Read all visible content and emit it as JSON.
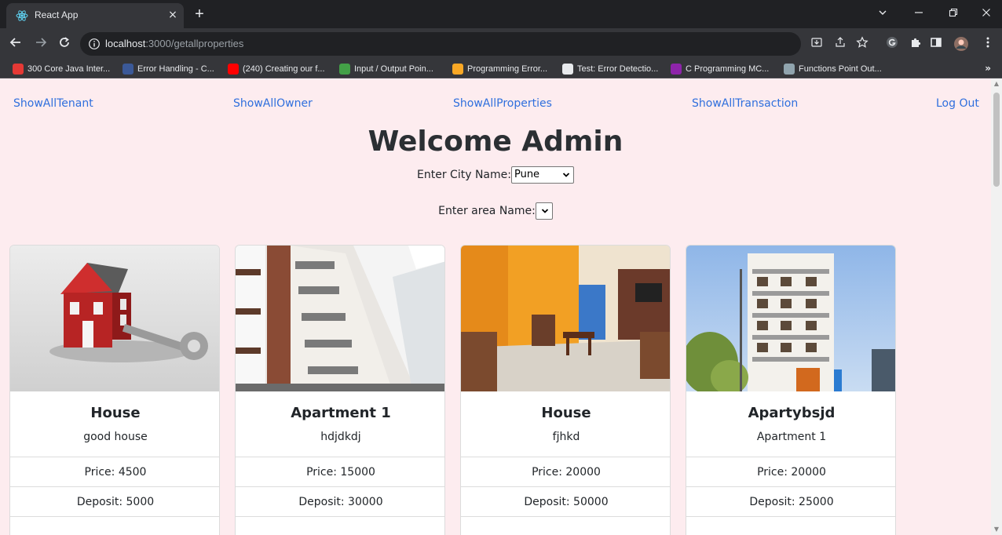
{
  "browser": {
    "tab_title": "React App",
    "tab_close": "×",
    "new_tab": "+",
    "url_host": "localhost",
    "url_rest": ":3000/getallproperties",
    "bookmarks": [
      {
        "label": "300 Core Java Inter...",
        "color": "#e53935"
      },
      {
        "label": "Error Handling - C...",
        "color": "#3b5998"
      },
      {
        "label": "(240) Creating our f...",
        "color": "#ff0000"
      },
      {
        "label": "Input / Output Poin...",
        "color": "#43a047"
      },
      {
        "label": "Programming Error...",
        "color": "#f9a825"
      },
      {
        "label": "Test: Error Detectio...",
        "color": "#e8eaed"
      },
      {
        "label": "C Programming MC...",
        "color": "#8e24aa"
      },
      {
        "label": "Functions Point Out...",
        "color": "#90a4ae"
      }
    ],
    "bookmarks_more": "»"
  },
  "nav": {
    "tenant": "ShowAllTenant",
    "owner": "ShowAllOwner",
    "properties": "ShowAllProperties",
    "transaction": "ShowAllTransaction",
    "logout": "Log Out"
  },
  "page": {
    "title": "Welcome Admin",
    "city_label": "Enter City Name:",
    "city_value": "Pune",
    "area_label": "Enter area Name:",
    "area_value": ""
  },
  "cards": [
    {
      "title": "House",
      "desc": "good house",
      "price": "Price: 4500",
      "deposit": "Deposit: 5000",
      "image": "house-key"
    },
    {
      "title": "Apartment 1",
      "desc": "hdjdkdj",
      "price": "Price: 15000",
      "deposit": "Deposit: 30000",
      "image": "apartment-building"
    },
    {
      "title": "House",
      "desc": "fjhkd",
      "price": "Price: 20000",
      "deposit": "Deposit: 50000",
      "image": "living-room"
    },
    {
      "title": "Apartybsjd",
      "desc": "Apartment 1",
      "price": "Price: 20000",
      "deposit": "Deposit: 25000",
      "image": "apartment-tower"
    }
  ],
  "colors": {
    "page_bg": "#fdecef",
    "link": "#2f6fdd",
    "browser_dark": "#202124",
    "browser_mid": "#35363a"
  }
}
